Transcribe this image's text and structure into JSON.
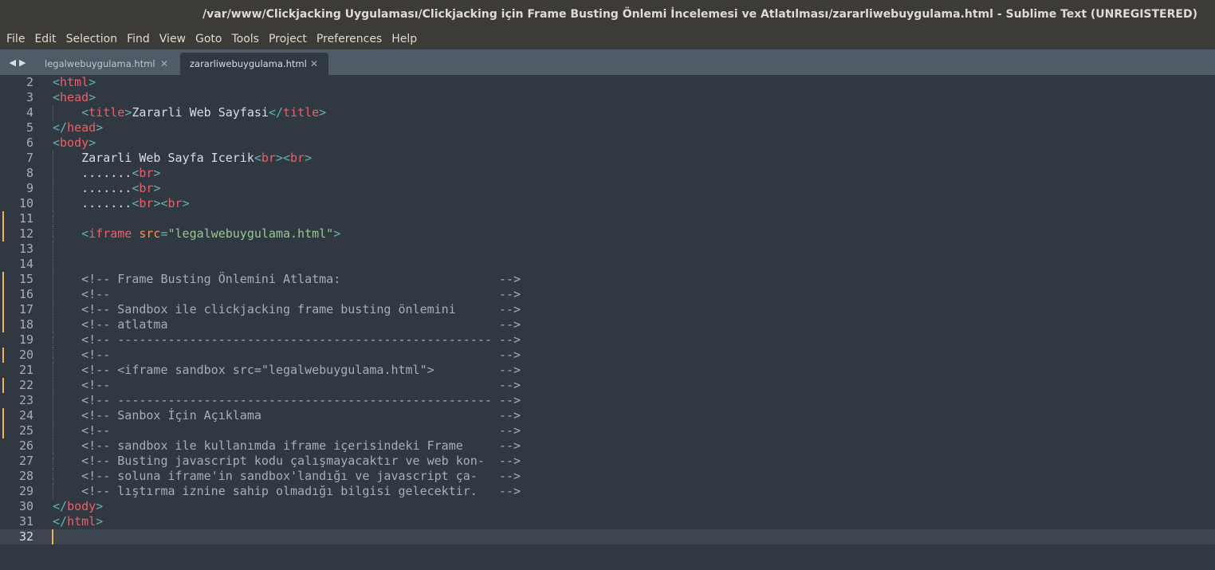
{
  "window": {
    "title": "/var/www/Clickjacking Uygulaması/Clickjacking için Frame Busting Önlemi İncelemesi ve Atlatılması/zararliwebuygulama.html - Sublime Text (UNREGISTERED)"
  },
  "menu": {
    "items": [
      "File",
      "Edit",
      "Selection",
      "Find",
      "View",
      "Goto",
      "Tools",
      "Project",
      "Preferences",
      "Help"
    ]
  },
  "tab_nav": {
    "prev_glyph": "◀",
    "next_glyph": "▶"
  },
  "tabs": [
    {
      "label": "legalwebuygulama.html",
      "close": "✕",
      "active": false
    },
    {
      "label": "zararliwebuygulama.html",
      "close": "✕",
      "active": true
    }
  ],
  "editor": {
    "current_line": 32,
    "colors": {
      "background": "#303841",
      "line_highlight": "#3d4650",
      "gutter_modified": "#f9ae58",
      "tag": "#ec5f67",
      "punctuation": "#5fb4b4",
      "attribute": "#f99157",
      "string": "#99c794",
      "text": "#d8dee9",
      "comment": "#a7adba"
    },
    "lines": [
      {
        "n": "2",
        "mod": false,
        "guide": false,
        "tokens": [
          [
            "punct",
            "<"
          ],
          [
            "tag",
            "html"
          ],
          [
            "punct",
            ">"
          ]
        ]
      },
      {
        "n": "3",
        "mod": false,
        "guide": false,
        "tokens": [
          [
            "punct",
            "<"
          ],
          [
            "tag",
            "head"
          ],
          [
            "punct",
            ">"
          ]
        ]
      },
      {
        "n": "4",
        "mod": false,
        "guide": true,
        "tokens": [
          [
            "text",
            "    "
          ],
          [
            "punct",
            "<"
          ],
          [
            "tag",
            "title"
          ],
          [
            "punct",
            ">"
          ],
          [
            "text",
            "Zararli Web Sayfasi"
          ],
          [
            "punct",
            "</"
          ],
          [
            "tag",
            "title"
          ],
          [
            "punct",
            ">"
          ]
        ]
      },
      {
        "n": "5",
        "mod": false,
        "guide": false,
        "tokens": [
          [
            "punct",
            "</"
          ],
          [
            "tag",
            "head"
          ],
          [
            "punct",
            ">"
          ]
        ]
      },
      {
        "n": "6",
        "mod": false,
        "guide": false,
        "tokens": [
          [
            "punct",
            "<"
          ],
          [
            "tag",
            "body"
          ],
          [
            "punct",
            ">"
          ]
        ]
      },
      {
        "n": "7",
        "mod": false,
        "guide": true,
        "tokens": [
          [
            "text",
            "    Zararli Web Sayfa Icerik"
          ],
          [
            "punct",
            "<"
          ],
          [
            "tag",
            "br"
          ],
          [
            "punct",
            "><"
          ],
          [
            "tag",
            "br"
          ],
          [
            "punct",
            ">"
          ]
        ]
      },
      {
        "n": "8",
        "mod": false,
        "guide": true,
        "tokens": [
          [
            "text",
            "    ......."
          ],
          [
            "punct",
            "<"
          ],
          [
            "tag",
            "br"
          ],
          [
            "punct",
            ">"
          ]
        ]
      },
      {
        "n": "9",
        "mod": false,
        "guide": true,
        "tokens": [
          [
            "text",
            "    ......."
          ],
          [
            "punct",
            "<"
          ],
          [
            "tag",
            "br"
          ],
          [
            "punct",
            ">"
          ]
        ]
      },
      {
        "n": "10",
        "mod": false,
        "guide": true,
        "tokens": [
          [
            "text",
            "    ......."
          ],
          [
            "punct",
            "<"
          ],
          [
            "tag",
            "br"
          ],
          [
            "punct",
            "><"
          ],
          [
            "tag",
            "br"
          ],
          [
            "punct",
            ">"
          ]
        ]
      },
      {
        "n": "11",
        "mod": true,
        "guide": true,
        "tokens": []
      },
      {
        "n": "12",
        "mod": true,
        "guide": true,
        "tokens": [
          [
            "text",
            "    "
          ],
          [
            "punct",
            "<"
          ],
          [
            "tag",
            "iframe"
          ],
          [
            "text",
            " "
          ],
          [
            "attr",
            "src"
          ],
          [
            "punct",
            "="
          ],
          [
            "str",
            "\"legalwebuygulama.html\""
          ],
          [
            "punct",
            ">"
          ]
        ]
      },
      {
        "n": "13",
        "mod": false,
        "guide": true,
        "tokens": []
      },
      {
        "n": "14",
        "mod": false,
        "guide": true,
        "tokens": []
      },
      {
        "n": "15",
        "mod": true,
        "guide": true,
        "tokens": [
          [
            "comment",
            "    <!-- Frame Busting Önlemini Atlatma:                      -->"
          ]
        ]
      },
      {
        "n": "16",
        "mod": true,
        "guide": true,
        "tokens": [
          [
            "comment",
            "    <!--                                                      -->"
          ]
        ]
      },
      {
        "n": "17",
        "mod": true,
        "guide": true,
        "tokens": [
          [
            "comment",
            "    <!-- Sandbox ile clickjacking frame busting önlemini      -->"
          ]
        ]
      },
      {
        "n": "18",
        "mod": true,
        "guide": true,
        "tokens": [
          [
            "comment",
            "    <!-- atlatma                                              -->"
          ]
        ]
      },
      {
        "n": "19",
        "mod": false,
        "guide": true,
        "tokens": [
          [
            "comment",
            "    <!-- ---------------------------------------------------- -->"
          ]
        ]
      },
      {
        "n": "20",
        "mod": true,
        "guide": true,
        "tokens": [
          [
            "comment",
            "    <!--                                                      -->"
          ]
        ]
      },
      {
        "n": "21",
        "mod": false,
        "guide": true,
        "tokens": [
          [
            "comment",
            "    <!-- <iframe sandbox src=\"legalwebuygulama.html\">         -->"
          ]
        ]
      },
      {
        "n": "22",
        "mod": true,
        "guide": true,
        "tokens": [
          [
            "comment",
            "    <!--                                                      -->"
          ]
        ]
      },
      {
        "n": "23",
        "mod": false,
        "guide": true,
        "tokens": [
          [
            "comment",
            "    <!-- ---------------------------------------------------- -->"
          ]
        ]
      },
      {
        "n": "24",
        "mod": true,
        "guide": true,
        "tokens": [
          [
            "comment",
            "    <!-- Sanbox İçin Açıklama                                 -->"
          ]
        ]
      },
      {
        "n": "25",
        "mod": true,
        "guide": true,
        "tokens": [
          [
            "comment",
            "    <!--                                                      -->"
          ]
        ]
      },
      {
        "n": "26",
        "mod": false,
        "guide": true,
        "tokens": [
          [
            "comment",
            "    <!-- sandbox ile kullanımda iframe içerisindeki Frame     -->"
          ]
        ]
      },
      {
        "n": "27",
        "mod": false,
        "guide": true,
        "tokens": [
          [
            "comment",
            "    <!-- Busting javascript kodu çalışmayacaktır ve web kon-  -->"
          ]
        ]
      },
      {
        "n": "28",
        "mod": false,
        "guide": true,
        "tokens": [
          [
            "comment",
            "    <!-- soluna iframe'in sandbox'landığı ve javascript ça-   -->"
          ]
        ]
      },
      {
        "n": "29",
        "mod": false,
        "guide": true,
        "tokens": [
          [
            "comment",
            "    <!-- lıştırma iznine sahip olmadığı bilgisi gelecektir.   -->"
          ]
        ]
      },
      {
        "n": "30",
        "mod": false,
        "guide": false,
        "tokens": [
          [
            "punct",
            "</"
          ],
          [
            "tag",
            "body"
          ],
          [
            "punct",
            ">"
          ]
        ]
      },
      {
        "n": "31",
        "mod": false,
        "guide": false,
        "tokens": [
          [
            "punct",
            "</"
          ],
          [
            "tag",
            "html"
          ],
          [
            "punct",
            ">"
          ]
        ]
      },
      {
        "n": "32",
        "mod": false,
        "guide": false,
        "tokens": []
      }
    ]
  }
}
